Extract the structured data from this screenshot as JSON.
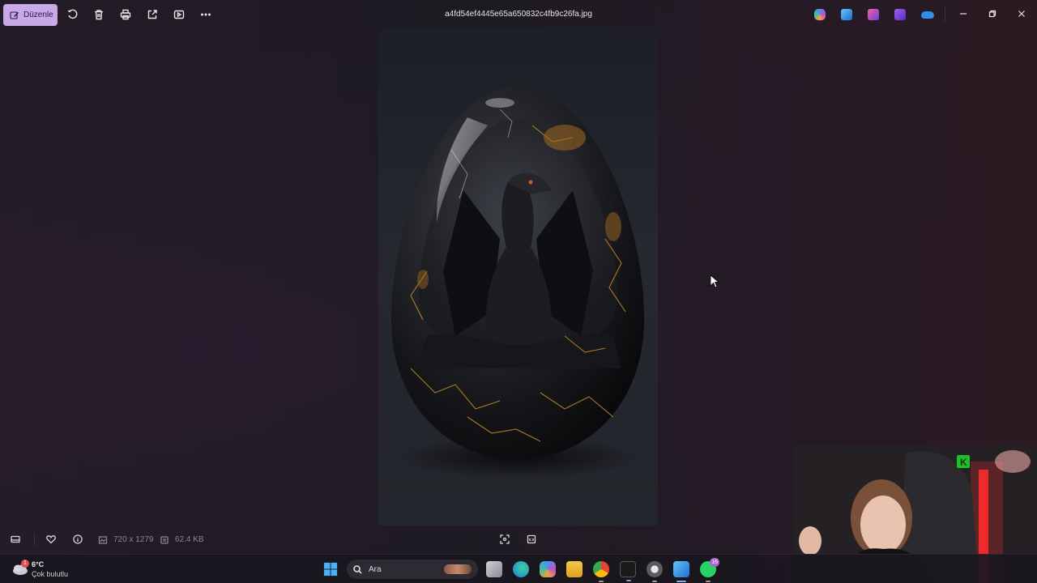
{
  "toolbar": {
    "edit_label": "Düzenle",
    "file_name": "a4fd54ef4445e65a650832c4fb9c26fa.jpg",
    "icons": [
      "rotate-icon",
      "trash-icon",
      "print-icon",
      "share-icon",
      "slideshow-icon",
      "more-icon"
    ],
    "apps": [
      {
        "name": "copilot-icon",
        "color": "#4f8ef7"
      },
      {
        "name": "photos-app-icon",
        "color": "#3aa0e8"
      },
      {
        "name": "designer-icon",
        "color": "#c050c8"
      },
      {
        "name": "clipchamp-icon",
        "color": "#8e4ee0"
      },
      {
        "name": "onedrive-icon",
        "color": "#2f8fe6"
      }
    ]
  },
  "info": {
    "dimensions": "720 x 1279",
    "file_size": "62.4 KB"
  },
  "taskbar": {
    "weather_temp": "6°C",
    "weather_condition": "Çok bulutlu",
    "weather_badge": "1",
    "search_placeholder": "Ara",
    "whatsapp_badge": "16"
  },
  "colors": {
    "accent": "#c9a9e8",
    "background": "#1f1b24"
  }
}
